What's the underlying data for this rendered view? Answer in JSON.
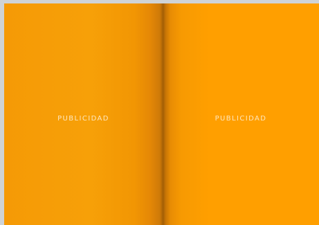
{
  "viewer": {
    "background_color": "#cfd3d6"
  },
  "spread": {
    "left_page": {
      "label": "PUBLICIDAD",
      "color": "#f7a008"
    },
    "right_page": {
      "label": "PUBLICIDAD",
      "color": "#ff9f00"
    }
  }
}
